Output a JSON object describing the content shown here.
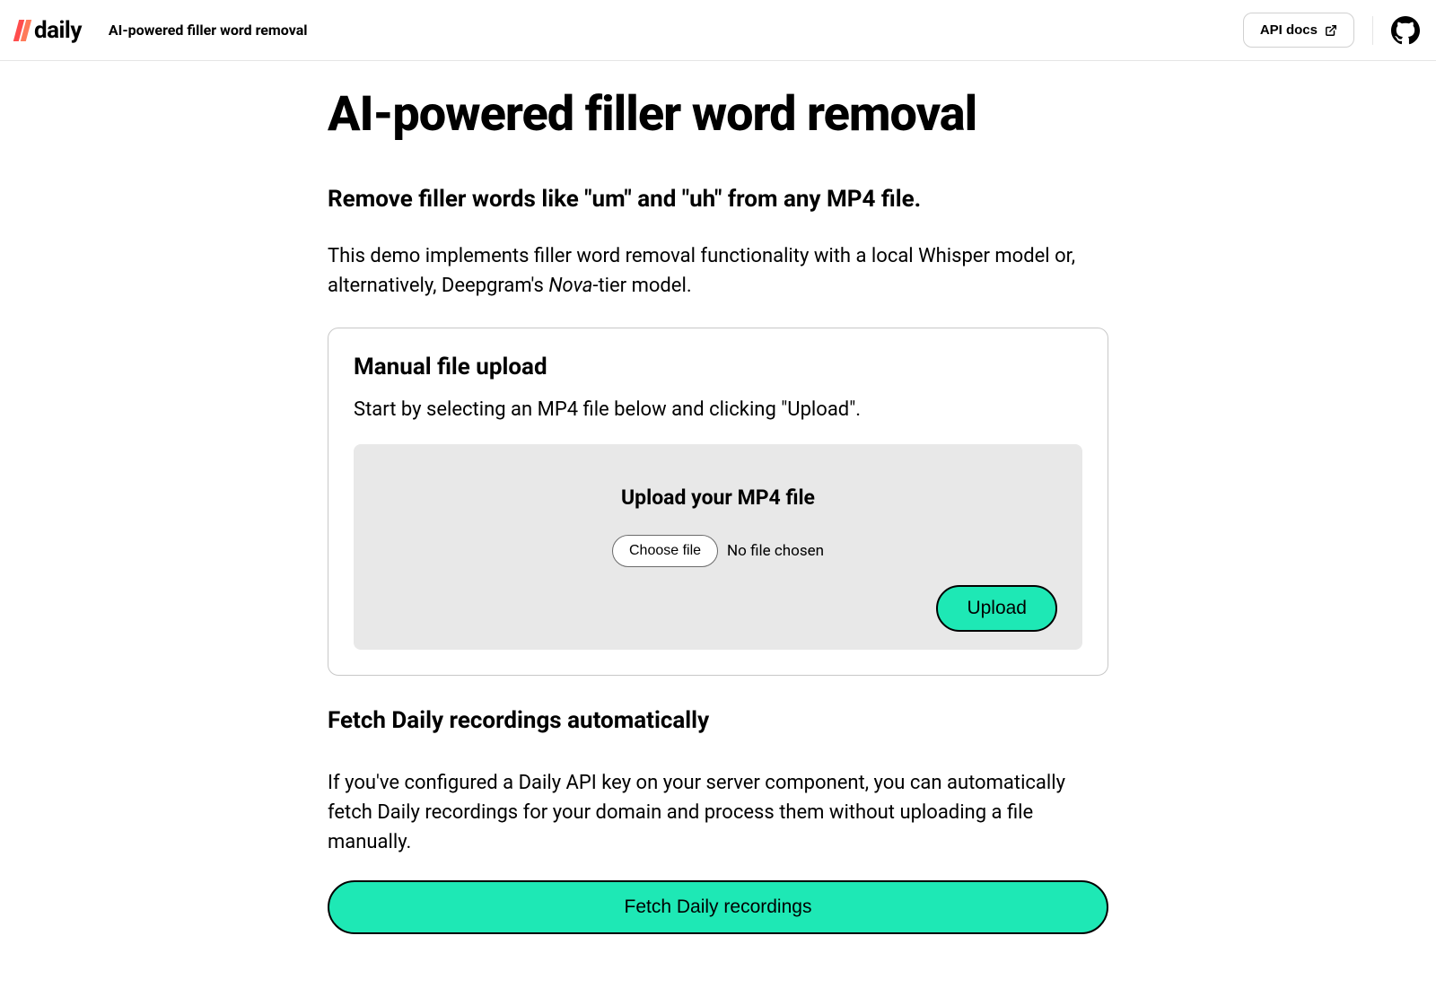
{
  "header": {
    "logo_text": "daily",
    "subtitle": "AI-powered filler word removal",
    "api_docs_label": "API docs"
  },
  "main": {
    "title": "AI-powered filler word removal",
    "subtitle": "Remove filler words like \"um\" and \"uh\" from any MP4 file.",
    "description_prefix": "This demo implements filler word removal functionality with a local Whisper model or, alternatively, Deepgram's ",
    "description_em": "Nova",
    "description_suffix": "-tier model."
  },
  "upload_card": {
    "title": "Manual file upload",
    "description": "Start by selecting an MP4 file below and clicking \"Upload\".",
    "zone_title": "Upload your MP4 file",
    "choose_file_label": "Choose file",
    "file_status": "No file chosen",
    "upload_button": "Upload"
  },
  "fetch_section": {
    "title": "Fetch Daily recordings automatically",
    "description": "If you've configured a Daily API key on your server component, you can automatically fetch Daily recordings for your domain and process them without uploading a file manually.",
    "button": "Fetch Daily recordings"
  }
}
